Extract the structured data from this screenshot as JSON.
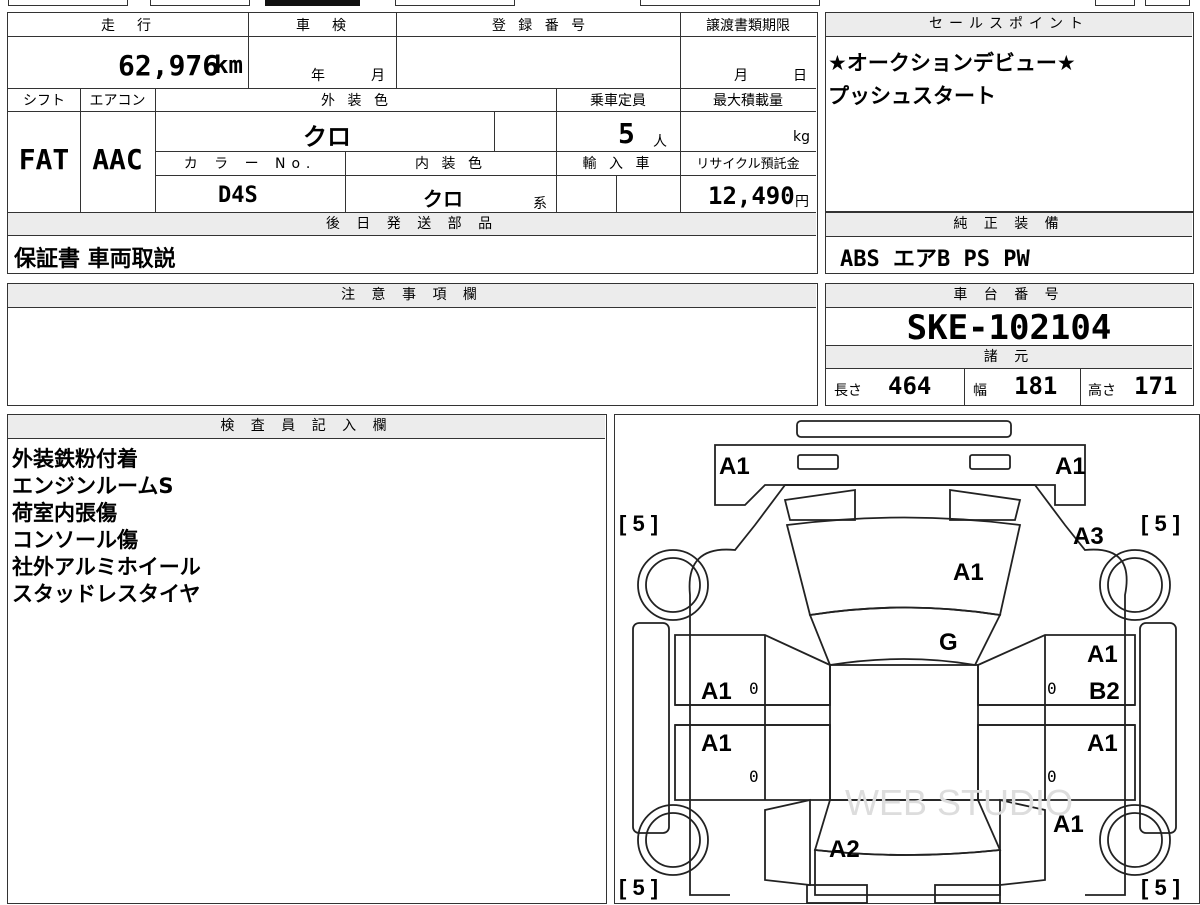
{
  "top_table": {
    "mileage_label": "走　行",
    "mileage_value": "62,976",
    "mileage_unit": "km",
    "inspection_label": "車　検",
    "inspection_year": "年",
    "inspection_month": "月",
    "registration_label": "登 録 番 号",
    "transfer_label": "譲渡書類期限",
    "transfer_month": "月",
    "transfer_day": "日",
    "shift_label": "シフト",
    "shift_value": "FAT",
    "aircon_label": "エアコン",
    "aircon_value": "AAC",
    "exterior_label": "外 装 色",
    "exterior_value": "クロ",
    "capacity_label": "乗車定員",
    "capacity_value": "5",
    "capacity_unit": "人",
    "payload_label": "最大積載量",
    "payload_unit": "kg",
    "color_no_label": "カ ラ ー No.",
    "color_no_value": "D4S",
    "interior_label": "内 装 色",
    "interior_value": "クロ",
    "interior_unit": "系",
    "import_label": "輸 入 車",
    "recycle_label": "リサイクル預託金",
    "recycle_value": "12,490",
    "recycle_unit": "円",
    "later_parts_label": "後 日 発 送 部 品",
    "later_parts_value": "保証書 車両取説"
  },
  "sales_point": {
    "label": "セールスポイント",
    "lines": [
      "★オークションデビュー★",
      "プッシュスタート"
    ]
  },
  "equipment": {
    "label": "純 正 装 備",
    "value": "ABS エアB PS PW"
  },
  "notes": {
    "label": "注 意 事 項 欄",
    "value": ""
  },
  "chassis": {
    "label": "車 台 番 号",
    "value": "SKE-102104"
  },
  "specs": {
    "label": "諸 元",
    "length_label": "長さ",
    "length_value": "464",
    "width_label": "幅",
    "width_value": "181",
    "height_label": "高さ",
    "height_value": "171"
  },
  "inspector": {
    "label": "検 査 員 記 入 欄",
    "lines": [
      "外装鉄粉付着",
      "エンジンルームS",
      "荷室内張傷",
      "コンソール傷",
      "社外アルミホイール",
      "スタッドレスタイヤ"
    ]
  },
  "diagram": {
    "tire_front_left": "[ 5 ]",
    "tire_front_right": "[ 5 ]",
    "tire_rear_left": "[ 5 ]",
    "tire_rear_right": "[ 5 ]",
    "front_left_corner": "A1",
    "front_right_corner": "A1",
    "right_front_fender": "A3",
    "hood": "A1",
    "windshield": "G",
    "right_front_door_1": "A1",
    "right_front_door_2": "B2",
    "left_front_door": "A1",
    "left_rear_door": "A1",
    "right_rear_door": "A1",
    "right_rear_fender": "A1",
    "rear_hatch": "A2",
    "zero_lf": "0",
    "zero_lr": "0",
    "zero_rf": "0",
    "zero_rr": "0",
    "watermark": "WEB STUDIO"
  }
}
